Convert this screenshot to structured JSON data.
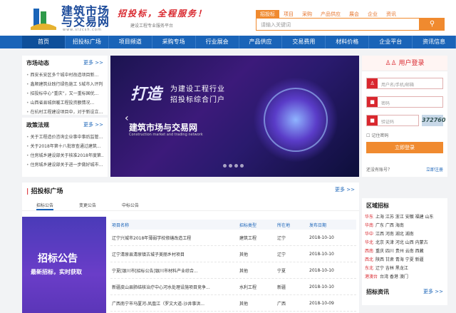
{
  "header": {
    "logo_title_line1": "建筑市场",
    "logo_title_line2": "与交易网",
    "logo_url": "www.slzcsh.com",
    "slogan": "招投标，全程服务！",
    "slogan_sub": "建设工程专业服务平台",
    "search_tabs": [
      "招投标",
      "项目",
      "采购",
      "产品供应",
      "展会",
      "企业",
      "资讯"
    ],
    "search_placeholder": "请输入关键词",
    "search_icon": "search-icon"
  },
  "nav": [
    "首页",
    "招投标广场",
    "项目频道",
    "采购专场",
    "行业展会",
    "产品供应",
    "交易费用",
    "材料价格",
    "企业平台",
    "资讯信息"
  ],
  "market_news": {
    "title": "市场动态",
    "more": "更多 >>",
    "items": [
      "西安长安区多个城中村改造项目新...",
      "鑫顺建筑业践行绿色施工 5城市入评判...",
      "招投标中心“重庆”，又一重标国优...",
      "山西省县城供暖工程投资额情况...",
      "在杭村工程建设项目中，对于新设立..."
    ]
  },
  "policy": {
    "title": "政策法规",
    "more": "更多 >>",
    "items": [
      "关于工程造价咨询企业事中事后监管...",
      "关于2018年第十八批审查通过建筑...",
      "住房城乡建设部关于核准2018年度第...",
      "住房城乡建设部关于进一步做好城市..."
    ]
  },
  "banner": {
    "big_char": "打造",
    "headline_1": "为建设工程行业",
    "headline_2": "招投标综合门户",
    "brand": "建筑市场与交易网",
    "brand_sub": "Construction market and trading network"
  },
  "login": {
    "title": "用户登录",
    "username_placeholder": "用户名/手机/邮箱",
    "password_placeholder": "密码",
    "captcha_placeholder": "验证码",
    "captcha_code": "372760",
    "remember": "记住密码",
    "submit": "立即登录",
    "forgot": "还没有账号？",
    "register": "立即注册"
  },
  "tender": {
    "title": "招投标广场",
    "more": "更多 >>",
    "tabs": [
      "招标公告",
      "变更公告",
      "中标公告"
    ],
    "promo_title": "招标公告",
    "promo_sub": "最新招标，实时获取",
    "columns": [
      "项目名称",
      "招标类型",
      "所在地",
      "发布日期"
    ],
    "rows": [
      {
        "name": "辽宁兴城市2018年薄弱学校修缮改造工程",
        "type": "建筑工程",
        "place": "辽宁",
        "date": "2018-10-10"
      },
      {
        "name": "辽宁清原县清原镇古城子美丽乡村项目",
        "type": "其他",
        "place": "辽宁",
        "date": "2018-10-10"
      },
      {
        "name": "宁夏[银川市[招标公告]银川市材料产业综合...",
        "type": "其他",
        "place": "宁夏",
        "date": "2018-10-10"
      },
      {
        "name": "新疆皮山县肺结核治疗中心河水处理设施项目竞争...",
        "type": "水利工程",
        "place": "新疆",
        "date": "2018-10-10"
      },
      {
        "name": "广西南宁市马厦河-凤凰江（罗文大道-沙井事洪...",
        "type": "其他",
        "place": "广西",
        "date": "2018-10-09"
      }
    ]
  },
  "region": {
    "title": "区域招标",
    "rows": [
      {
        "tag": "华东",
        "text": "上海 江苏 浙江 安徽 福建 山东"
      },
      {
        "tag": "华南",
        "text": "广东 广西 海南"
      },
      {
        "tag": "华中",
        "text": "江西 河南 湖北 湖南"
      },
      {
        "tag": "华北",
        "text": "北京 天津 河北 山西 内蒙古"
      },
      {
        "tag": "西南",
        "text": "重庆 四川 贵州 云南 西藏"
      },
      {
        "tag": "西北",
        "text": "陕西 甘肃 青海 宁夏 新疆"
      },
      {
        "tag": "东北",
        "text": "辽宁 吉林 黑龙江"
      },
      {
        "tag": "港澳台",
        "text": "台湾 香港 澳门"
      }
    ],
    "news_title": "招标资讯",
    "news_more": "更多 >>"
  }
}
